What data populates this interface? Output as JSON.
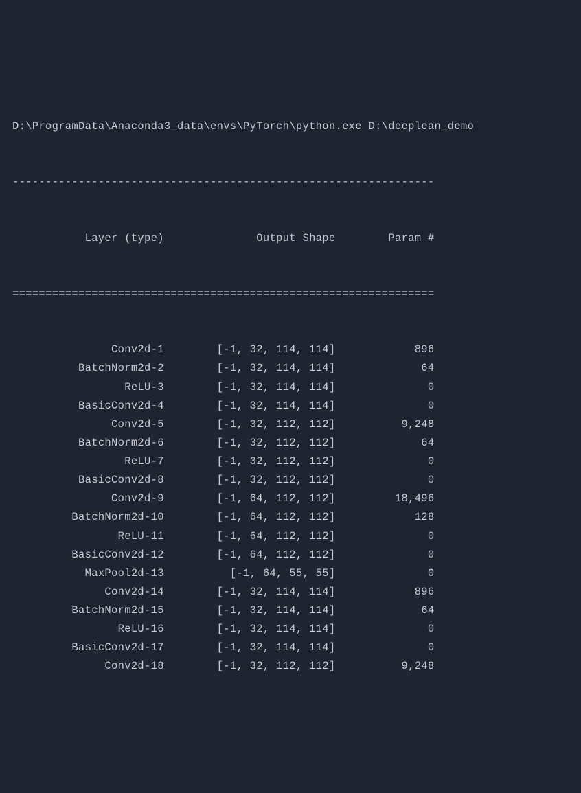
{
  "command_line": "D:\\ProgramData\\Anaconda3_data\\envs\\PyTorch\\python.exe D:\\deeplean_demo",
  "divider_dash": "----------------------------------------------------------------",
  "divider_eq": "================================================================",
  "header": {
    "layer": "Layer (type)",
    "output_shape": "Output Shape",
    "param": "Param #"
  },
  "rows": [
    {
      "layer": "Conv2d-1",
      "shape": "[-1, 32, 114, 114]",
      "param": "896"
    },
    {
      "layer": "BatchNorm2d-2",
      "shape": "[-1, 32, 114, 114]",
      "param": "64"
    },
    {
      "layer": "ReLU-3",
      "shape": "[-1, 32, 114, 114]",
      "param": "0"
    },
    {
      "layer": "BasicConv2d-4",
      "shape": "[-1, 32, 114, 114]",
      "param": "0"
    },
    {
      "layer": "Conv2d-5",
      "shape": "[-1, 32, 112, 112]",
      "param": "9,248"
    },
    {
      "layer": "BatchNorm2d-6",
      "shape": "[-1, 32, 112, 112]",
      "param": "64"
    },
    {
      "layer": "ReLU-7",
      "shape": "[-1, 32, 112, 112]",
      "param": "0"
    },
    {
      "layer": "BasicConv2d-8",
      "shape": "[-1, 32, 112, 112]",
      "param": "0"
    },
    {
      "layer": "Conv2d-9",
      "shape": "[-1, 64, 112, 112]",
      "param": "18,496"
    },
    {
      "layer": "BatchNorm2d-10",
      "shape": "[-1, 64, 112, 112]",
      "param": "128"
    },
    {
      "layer": "ReLU-11",
      "shape": "[-1, 64, 112, 112]",
      "param": "0"
    },
    {
      "layer": "BasicConv2d-12",
      "shape": "[-1, 64, 112, 112]",
      "param": "0"
    },
    {
      "layer": "MaxPool2d-13",
      "shape": "[-1, 64, 55, 55]",
      "param": "0"
    },
    {
      "layer": "Conv2d-14",
      "shape": "[-1, 32, 114, 114]",
      "param": "896"
    },
    {
      "layer": "BatchNorm2d-15",
      "shape": "[-1, 32, 114, 114]",
      "param": "64"
    },
    {
      "layer": "ReLU-16",
      "shape": "[-1, 32, 114, 114]",
      "param": "0"
    },
    {
      "layer": "BasicConv2d-17",
      "shape": "[-1, 32, 114, 114]",
      "param": "0"
    },
    {
      "layer": "Conv2d-18",
      "shape": "[-1, 32, 112, 112]",
      "param": "9,248"
    }
  ],
  "col_widths": {
    "layer": 23,
    "shape": 26,
    "param": 15
  }
}
